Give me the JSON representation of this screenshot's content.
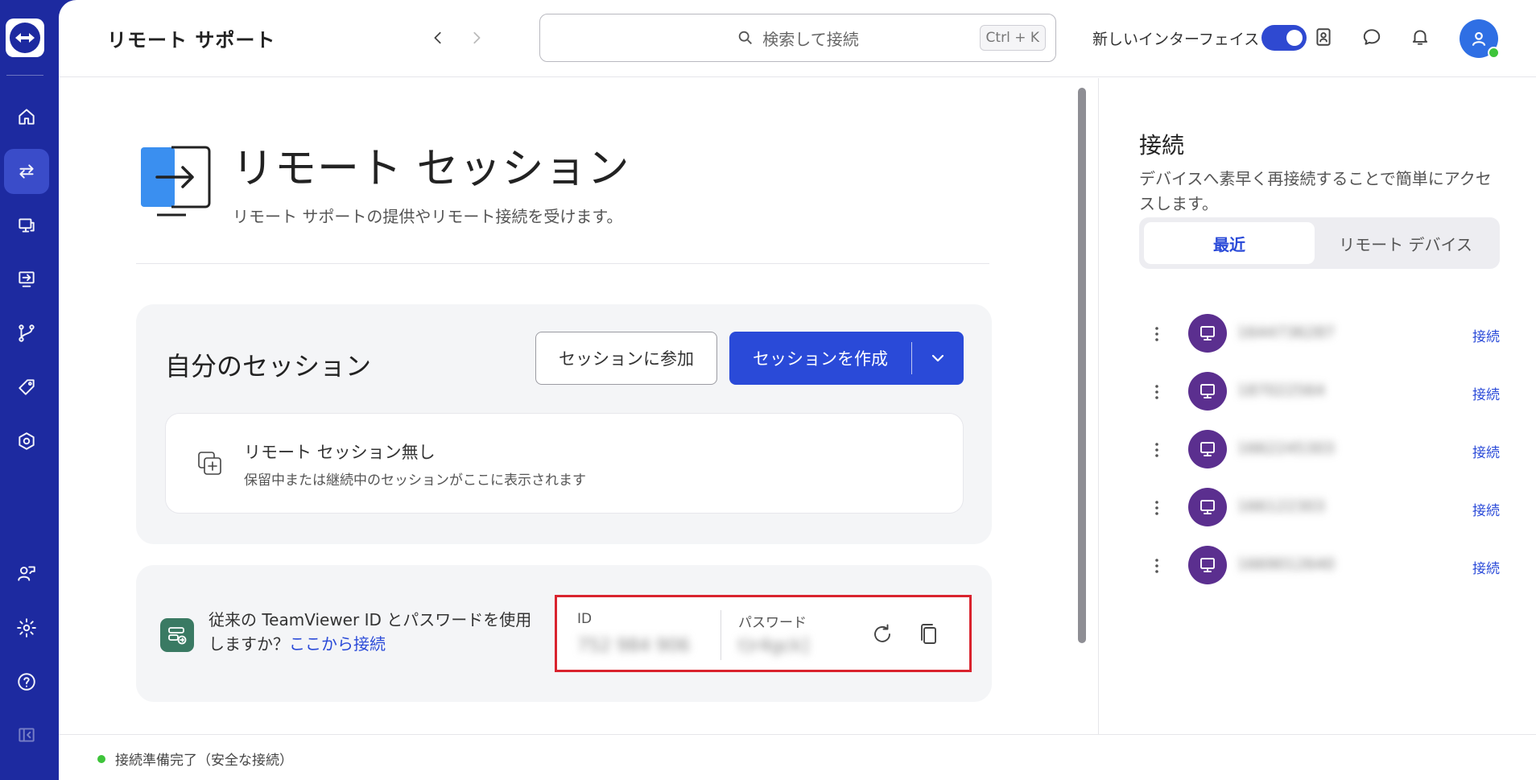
{
  "header": {
    "app_title": "リモート サポート",
    "search_placeholder": "検索して接続",
    "search_shortcut": "Ctrl + K",
    "new_ui_label": "新しいインターフェイス",
    "new_ui_enabled": true
  },
  "sidebar": {
    "items": [
      {
        "icon": "home-icon",
        "active": false
      },
      {
        "icon": "swap-arrows-icon",
        "active": true
      },
      {
        "icon": "device-monitor-icon",
        "active": false
      },
      {
        "icon": "remote-screen-icon",
        "active": false
      },
      {
        "icon": "branch-icon",
        "active": false
      },
      {
        "icon": "tag-icon",
        "active": false
      },
      {
        "icon": "settings-hex-icon",
        "active": false
      },
      {
        "icon": "user-chat-icon",
        "active": false
      },
      {
        "icon": "gear-icon",
        "active": false
      },
      {
        "icon": "help-icon",
        "active": false
      },
      {
        "icon": "collapse-sidebar-icon",
        "active": false
      }
    ]
  },
  "main": {
    "title": "リモート セッション",
    "subtitle": "リモート サポートの提供やリモート接続を受けます。",
    "my_sessions": {
      "title": "自分のセッション",
      "join_label": "セッションに参加",
      "create_label": "セッションを作成",
      "empty_title": "リモート セッション無し",
      "empty_subtitle": "保留中または継続中のセッションがここに表示されます"
    },
    "legacy": {
      "text": "従来の TeamViewer ID とパスワードを使用しますか？",
      "link": "ここから接続",
      "id_label": "ID",
      "id_value": "752 984 906",
      "password_label": "パスワード",
      "password_value": "t)r4gck]"
    }
  },
  "right_panel": {
    "title": "接続",
    "description": "デバイスへ素早く再接続することで簡単にアクセスします。",
    "tabs": [
      {
        "label": "最近",
        "active": true
      },
      {
        "label": "リモート デバイス",
        "active": false
      }
    ],
    "devices": [
      {
        "id": "1644736287",
        "action": "接続"
      },
      {
        "id": "187022564",
        "action": "接続"
      },
      {
        "id": "1662245303",
        "action": "接続"
      },
      {
        "id": "166122303",
        "action": "接続"
      },
      {
        "id": "1669012640",
        "action": "接続"
      }
    ]
  },
  "status": {
    "text": "接続準備完了（安全な接続）",
    "color": "#3ec43a"
  },
  "colors": {
    "sidebar": "#1d2aa0",
    "accent": "#2a4ad8",
    "device_avatar": "#5b2f8f",
    "highlight_border": "#d9232e"
  }
}
